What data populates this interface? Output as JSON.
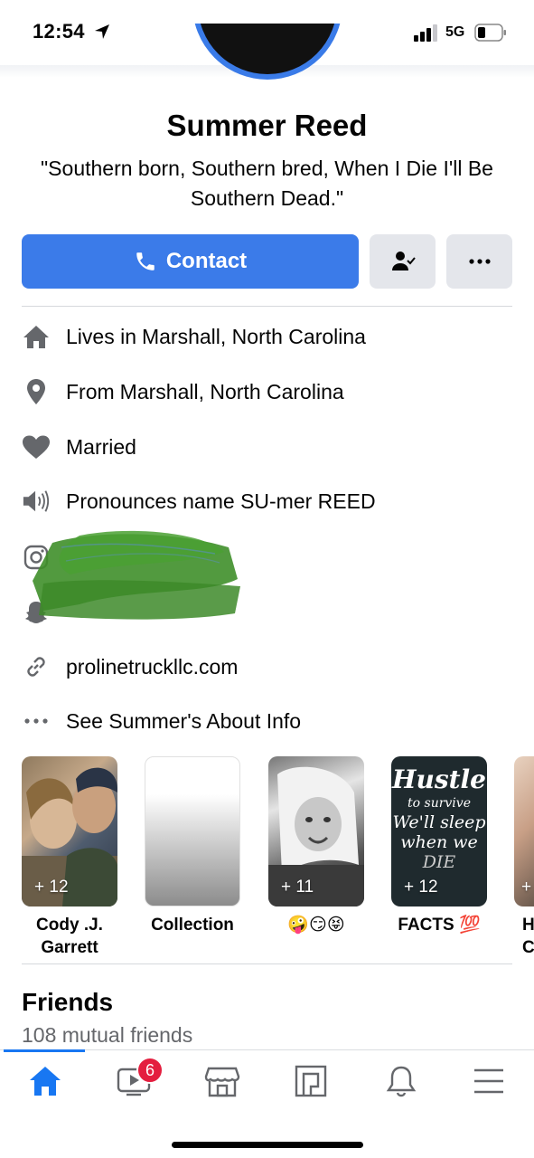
{
  "status": {
    "time": "12:54",
    "network": "5G"
  },
  "profile": {
    "name": "Summer Reed",
    "bio": "\"Southern born, Southern bred, When I Die I'll Be Southern Dead.\""
  },
  "actions": {
    "contact_label": "Contact"
  },
  "info": {
    "lives_prefix": "Lives in",
    "lives_place": "Marshall, North Carolina",
    "from_prefix": "From",
    "from_place": "Marshall, North Carolina",
    "relationship": "Married",
    "pronounce": "Pronounces name SU-mer REED",
    "website": "prolinetruckllc.com",
    "about_link": "See Summer's About Info"
  },
  "highlights": [
    {
      "label": "Cody .J. Garrett",
      "count": "+ 12",
      "type": "photo-couple"
    },
    {
      "label": "Collection",
      "count": "",
      "type": "gradient"
    },
    {
      "label": "🤪😏😝",
      "count": "+ 11",
      "type": "photo-bw"
    },
    {
      "label": "FACTS 💯",
      "count": "+ 12",
      "type": "text-hustle",
      "art_text": [
        "Hustle",
        "to survive",
        "We'll sleep",
        "when we",
        "DIE"
      ]
    },
    {
      "label": "H C",
      "count": "+",
      "type": "photo-partial"
    }
  ],
  "friends": {
    "title": "Friends",
    "mutual": "108 mutual friends"
  },
  "tabbar": {
    "items": [
      "home-icon",
      "watch-icon",
      "marketplace-icon",
      "pages-icon",
      "notifications-icon",
      "menu-icon"
    ],
    "watch_badge": "6",
    "active_color": "#1877f2"
  },
  "colors": {
    "primary": "#3b7be9",
    "icon_gray": "#65676b",
    "badge_red": "#e41e3f"
  }
}
